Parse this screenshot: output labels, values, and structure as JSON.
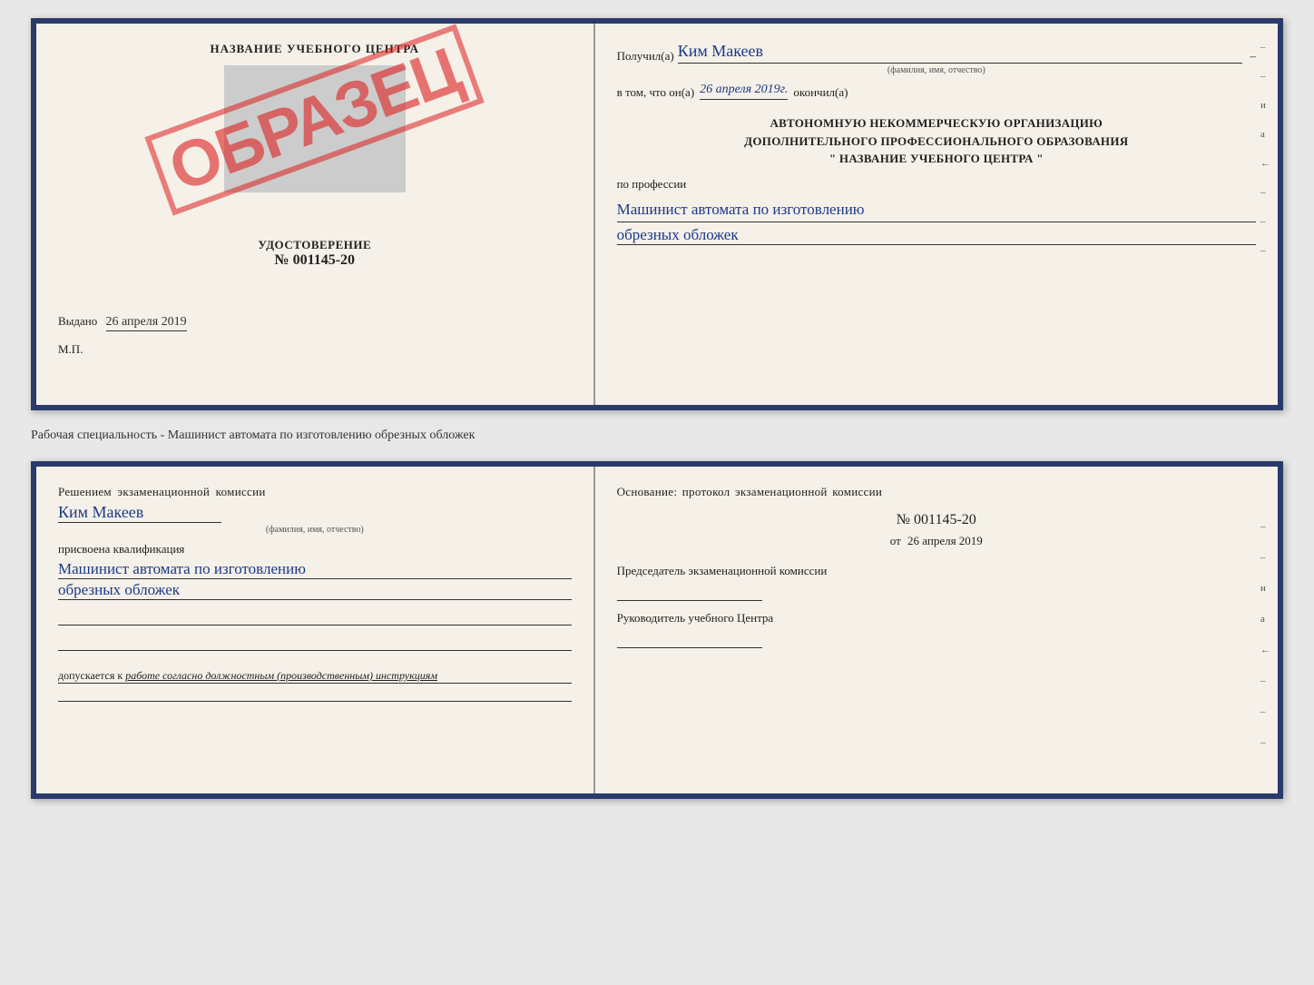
{
  "doc1": {
    "left": {
      "title": "НАЗВАНИЕ УЧЕБНОГО ЦЕНТРА",
      "stamp_text": "ОБРАЗЕЦ",
      "udostoverenie_title": "УДОСТОВЕРЕНИЕ",
      "number": "№ 001145-20",
      "vydano": "Выдано",
      "vydano_date": "26 апреля 2019",
      "mp": "М.П."
    },
    "right": {
      "poluchil": "Получил(а)",
      "name": "Ким Макеев",
      "fio_label": "(фамилия, имя, отчество)",
      "vtom": "в том, что он(а)",
      "date": "26 апреля 2019г.",
      "okonchil": "окончил(а)",
      "org_line1": "АВТОНОМНУЮ НЕКОММЕРЧЕСКУЮ ОРГАНИЗАЦИЮ",
      "org_line2": "ДОПОЛНИТЕЛЬНОГО ПРОФЕССИОНАЛЬНОГО ОБРАЗОВАНИЯ",
      "org_line3": "\"  НАЗВАНИЕ УЧЕБНОГО ЦЕНТРА  \"",
      "po_professii": "по профессии",
      "profession1": "Машинист автомата по изготовлению",
      "profession2": "обрезных обложек"
    }
  },
  "middle_label": "Рабочая специальность - Машинист автомата по изготовлению обрезных обложек",
  "doc2": {
    "left": {
      "resheniem": "Решением экзаменационной комиссии",
      "name": "Ким Макеев",
      "fio_label": "(фамилия, имя, отчество)",
      "prisvoena": "присвоена квалификация",
      "prof1": "Машинист автомата по изготовлению",
      "prof2": "обрезных обложек",
      "dopusk_prefix": "допускается к",
      "dopusk_italic": "работе согласно должностным (производственным) инструкциям"
    },
    "right": {
      "osnovanie": "Основание: протокол экзаменационной комиссии",
      "number": "№  001145-20",
      "ot": "от",
      "date": "26 апреля 2019",
      "predsedatel_title": "Председатель экзаменационной комиссии",
      "rukovoditel_title": "Руководитель учебного Центра"
    }
  },
  "right_marks": [
    "-",
    "-",
    "и",
    "а",
    "←",
    "-",
    "-",
    "-"
  ]
}
